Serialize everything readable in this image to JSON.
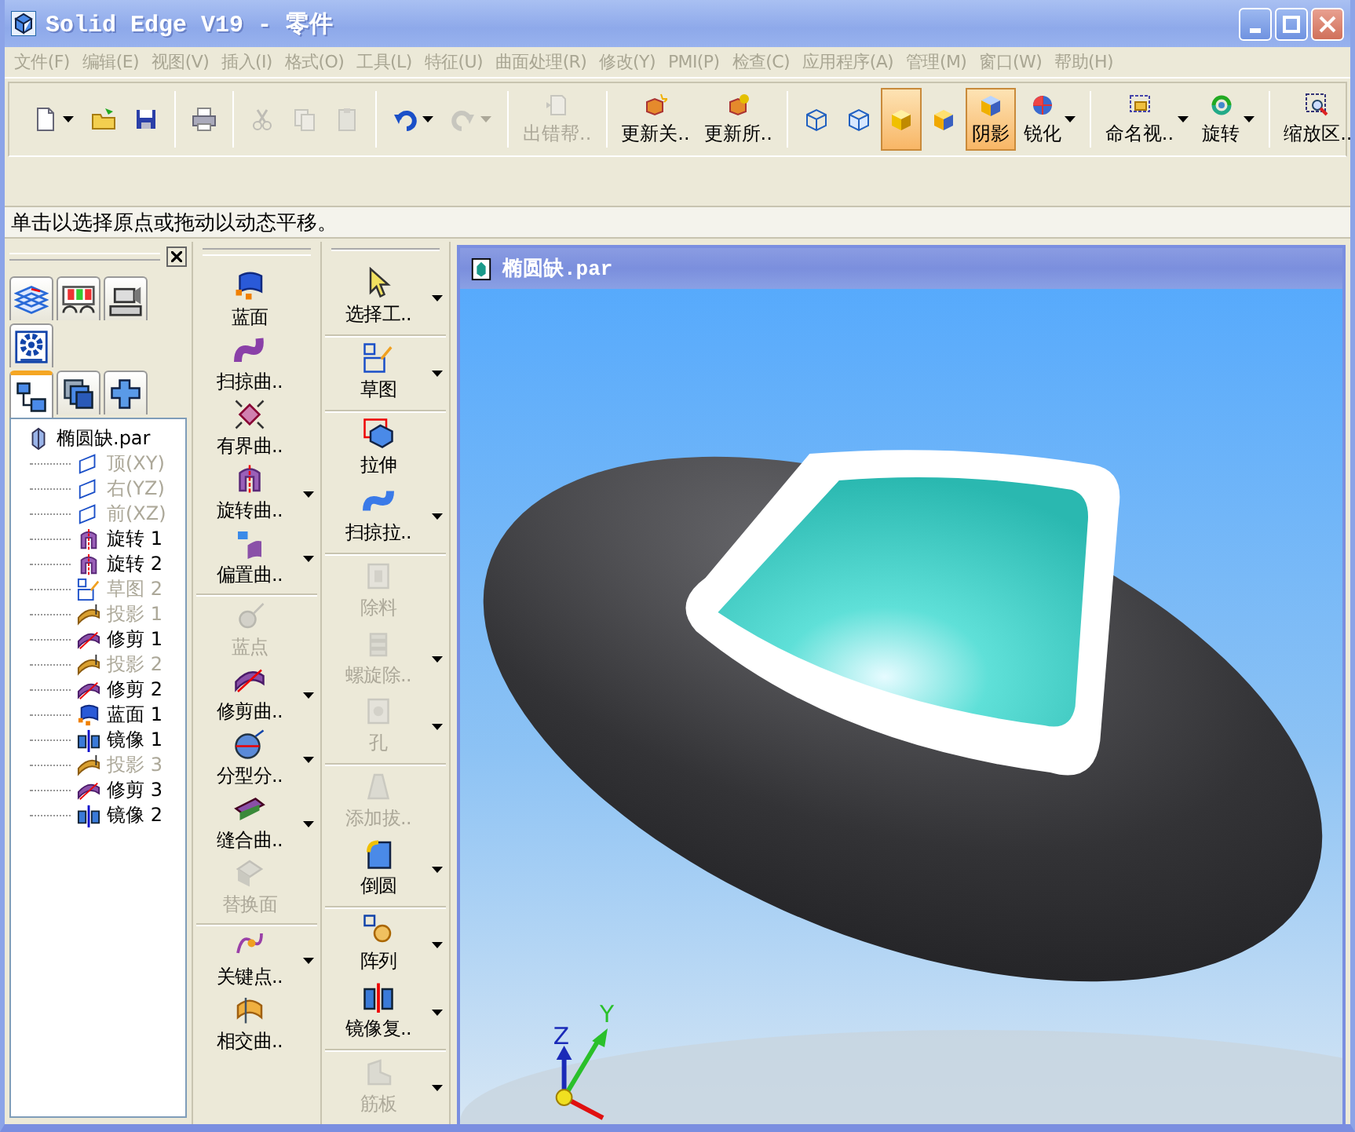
{
  "window": {
    "title": "Solid Edge V19 - 零件"
  },
  "menu": [
    {
      "label": "文件(F)",
      "disabled": true
    },
    {
      "label": "编辑(E)",
      "disabled": true
    },
    {
      "label": "视图(V)",
      "disabled": true
    },
    {
      "label": "插入(I)",
      "disabled": true
    },
    {
      "label": "格式(O)",
      "disabled": true
    },
    {
      "label": "工具(L)",
      "disabled": true
    },
    {
      "label": "特征(U)",
      "disabled": true
    },
    {
      "label": "曲面处理(R)",
      "disabled": true
    },
    {
      "label": "修改(Y)",
      "disabled": true
    },
    {
      "label": "PMI(P)",
      "disabled": true
    },
    {
      "label": "检查(C)",
      "disabled": true
    },
    {
      "label": "应用程序(A)",
      "disabled": true
    },
    {
      "label": "管理(M)",
      "disabled": true
    },
    {
      "label": "窗口(W)",
      "disabled": true
    },
    {
      "label": "帮助(H)",
      "disabled": true
    }
  ],
  "toolbar": [
    {
      "kind": "new",
      "dropdown": true,
      "disabled": false,
      "selected": false
    },
    {
      "kind": "open",
      "dropdown": false,
      "disabled": false,
      "selected": false
    },
    {
      "kind": "save",
      "dropdown": false,
      "disabled": false,
      "selected": false
    },
    {
      "kind": "sep"
    },
    {
      "kind": "print",
      "dropdown": false,
      "disabled": false,
      "selected": false
    },
    {
      "kind": "sep"
    },
    {
      "kind": "cut",
      "dropdown": false,
      "disabled": true,
      "selected": false
    },
    {
      "kind": "copy",
      "dropdown": false,
      "disabled": true,
      "selected": false
    },
    {
      "kind": "paste",
      "dropdown": false,
      "disabled": true,
      "selected": false
    },
    {
      "kind": "sep"
    },
    {
      "kind": "undo",
      "dropdown": true,
      "disabled": false,
      "selected": false
    },
    {
      "kind": "redo",
      "dropdown": true,
      "disabled": true,
      "selected": false
    },
    {
      "kind": "sep"
    },
    {
      "kind": "errhelp",
      "label": "出错帮..",
      "dropdown": false,
      "disabled": true,
      "selected": false
    },
    {
      "kind": "sep"
    },
    {
      "kind": "update",
      "label": "更新关..",
      "dropdown": false,
      "disabled": false,
      "selected": false
    },
    {
      "kind": "updateall",
      "label": "更新所..",
      "dropdown": false,
      "disabled": false,
      "selected": false
    },
    {
      "kind": "sep"
    },
    {
      "kind": "wire",
      "dropdown": false,
      "disabled": false,
      "selected": false
    },
    {
      "kind": "wire2",
      "dropdown": false,
      "disabled": false,
      "selected": false
    },
    {
      "kind": "shaded",
      "dropdown": false,
      "disabled": false,
      "selected": true
    },
    {
      "kind": "shaded2",
      "dropdown": false,
      "disabled": false,
      "selected": false
    },
    {
      "kind": "shade",
      "label": "阴影",
      "dropdown": false,
      "disabled": false,
      "selected": true
    },
    {
      "kind": "sharpen",
      "label": "锐化",
      "dropdown": true,
      "disabled": false,
      "selected": false
    },
    {
      "kind": "sep"
    },
    {
      "kind": "namedview",
      "label": "命名视..",
      "dropdown": true,
      "disabled": false,
      "selected": false
    },
    {
      "kind": "rotate",
      "label": "旋转",
      "dropdown": true,
      "disabled": false,
      "selected": false
    },
    {
      "kind": "sep"
    },
    {
      "kind": "zoomarea",
      "label": "缩放区..",
      "dropdown": false,
      "disabled": false,
      "selected": false
    }
  ],
  "prompt": "单击以选择原点或拖动以动态平移。",
  "pathfinder": {
    "tool_tabs": [
      {
        "kind": "layers"
      },
      {
        "kind": "colors"
      },
      {
        "kind": "camera"
      },
      {
        "kind": "gear"
      }
    ],
    "tabs": [
      {
        "kind": "tree",
        "selected": true
      },
      {
        "kind": "stack",
        "selected": false
      },
      {
        "kind": "puzzle",
        "selected": false
      }
    ],
    "tree": {
      "label": "椭圆缺.par",
      "kind": "part",
      "disabled": false,
      "children": [
        {
          "label": "顶(XY)",
          "kind": "plane",
          "disabled": true
        },
        {
          "label": "右(YZ)",
          "kind": "plane",
          "disabled": true
        },
        {
          "label": "前(XZ)",
          "kind": "plane",
          "disabled": true
        },
        {
          "label": "旋转 1",
          "kind": "revolve",
          "disabled": false
        },
        {
          "label": "旋转 2",
          "kind": "revolve",
          "disabled": false
        },
        {
          "label": "草图 2",
          "kind": "sketch",
          "disabled": true
        },
        {
          "label": "投影 1",
          "kind": "project",
          "disabled": true
        },
        {
          "label": "修剪 1",
          "kind": "trim",
          "disabled": false
        },
        {
          "label": "投影 2",
          "kind": "project",
          "disabled": true
        },
        {
          "label": "修剪 2",
          "kind": "trim",
          "disabled": false
        },
        {
          "label": "蓝面 1",
          "kind": "bluesurf",
          "disabled": false
        },
        {
          "label": "镜像 1",
          "kind": "mirror",
          "disabled": false
        },
        {
          "label": "投影 3",
          "kind": "project",
          "disabled": true
        },
        {
          "label": "修剪 3",
          "kind": "trim",
          "disabled": false
        },
        {
          "label": "镜像 2",
          "kind": "mirror",
          "disabled": false
        }
      ]
    }
  },
  "ribbons": [
    {
      "groups": [
        {
          "items": [
            {
              "kind": "bluesurf",
              "label": "蓝面",
              "dropdown": false,
              "disabled": false
            },
            {
              "kind": "swept",
              "label": "扫掠曲..",
              "dropdown": false,
              "disabled": false
            },
            {
              "kind": "bounded",
              "label": "有界曲..",
              "dropdown": false,
              "disabled": false
            },
            {
              "kind": "revolve",
              "label": "旋转曲..",
              "dropdown": true,
              "disabled": false
            },
            {
              "kind": "offset",
              "label": "偏置曲..",
              "dropdown": true,
              "disabled": false
            }
          ]
        },
        {
          "items": [
            {
              "kind": "bluedot",
              "label": "蓝点",
              "dropdown": false,
              "disabled": true
            },
            {
              "kind": "trim",
              "label": "修剪曲..",
              "dropdown": true,
              "disabled": false
            },
            {
              "kind": "parting",
              "label": "分型分..",
              "dropdown": true,
              "disabled": false
            },
            {
              "kind": "stitch",
              "label": "缝合曲..",
              "dropdown": true,
              "disabled": false
            },
            {
              "kind": "replace",
              "label": "替换面",
              "dropdown": false,
              "disabled": true
            }
          ]
        },
        {
          "items": [
            {
              "kind": "keypoint",
              "label": "关键点..",
              "dropdown": true,
              "disabled": false
            },
            {
              "kind": "intersect",
              "label": "相交曲..",
              "dropdown": false,
              "disabled": false
            }
          ]
        }
      ]
    },
    {
      "groups": [
        {
          "items": [
            {
              "kind": "select",
              "label": "选择工..",
              "dropdown": true,
              "disabled": false
            }
          ]
        },
        {
          "items": [
            {
              "kind": "sketch",
              "label": "草图",
              "dropdown": true,
              "disabled": false
            }
          ]
        },
        {
          "items": [
            {
              "kind": "extrude",
              "label": "拉伸",
              "dropdown": false,
              "disabled": false
            },
            {
              "kind": "sweptprot",
              "label": "扫掠拉..",
              "dropdown": true,
              "disabled": false
            }
          ]
        },
        {
          "items": [
            {
              "kind": "cutout",
              "label": "除料",
              "dropdown": false,
              "disabled": true
            },
            {
              "kind": "helix",
              "label": "螺旋除..",
              "dropdown": true,
              "disabled": true
            },
            {
              "kind": "hole",
              "label": "孔",
              "dropdown": true,
              "disabled": true
            }
          ]
        },
        {
          "items": [
            {
              "kind": "draft",
              "label": "添加拔..",
              "dropdown": false,
              "disabled": true
            },
            {
              "kind": "round",
              "label": "倒圆",
              "dropdown": true,
              "disabled": false
            }
          ]
        },
        {
          "items": [
            {
              "kind": "pattern",
              "label": "阵列",
              "dropdown": true,
              "disabled": false
            },
            {
              "kind": "mirrorcopy",
              "label": "镜像复..",
              "dropdown": true,
              "disabled": false
            }
          ]
        },
        {
          "items": [
            {
              "kind": "rib",
              "label": "筋板",
              "dropdown": true,
              "disabled": true
            }
          ]
        }
      ]
    }
  ],
  "viewport": {
    "title": "椭圆缺.par",
    "axes": [
      {
        "kind": "z",
        "label": "Z"
      },
      {
        "kind": "y",
        "label": "Y"
      }
    ]
  }
}
